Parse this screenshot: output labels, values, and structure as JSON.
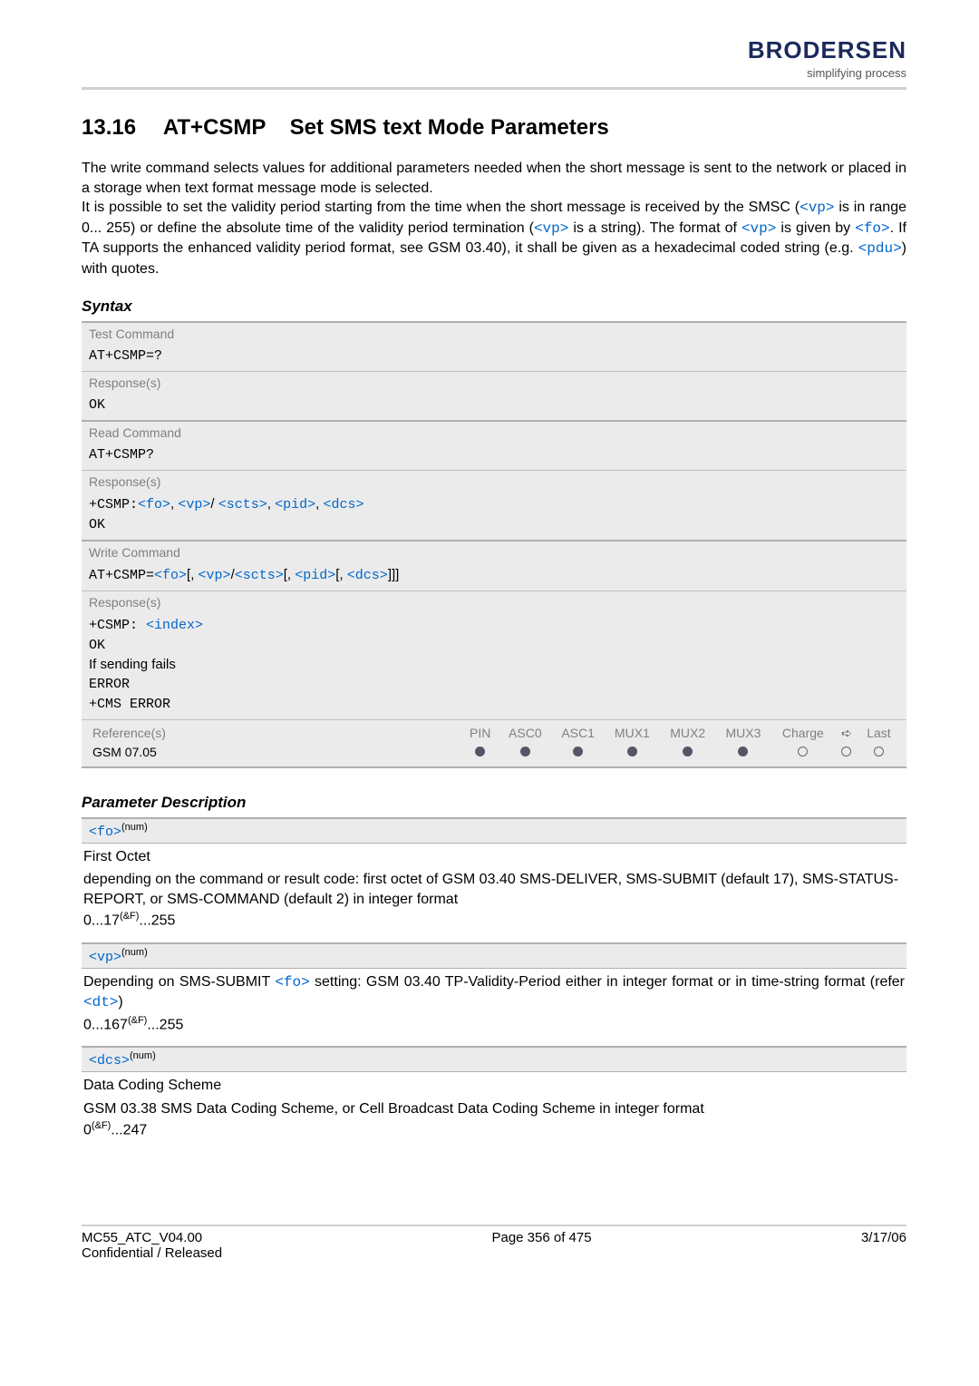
{
  "header": {
    "logo": "BRODERSEN",
    "tagline": "simplifying process"
  },
  "title": {
    "number": "13.16",
    "command": "AT+CSMP",
    "name": "Set SMS text Mode Parameters"
  },
  "intro": {
    "p1a": "The write command selects values for additional parameters needed when the short message is sent to the network or placed in a storage when text format message mode is selected.",
    "p2a": "It is possible to set the validity period starting from the time when the short message is received by the SMSC (",
    "vp1": "<vp>",
    "p2b": " is in range 0... 255) or define the absolute time of the validity period termination (",
    "vp2": "<vp>",
    "p2c": " is a string). The format of ",
    "vp3": "<vp>",
    "p2d": " is given by ",
    "fo1": "<fo>",
    "p2e": ". If TA supports the enhanced validity period format, see GSM 03.40), it shall be given as a hexadecimal coded string (e.g. ",
    "pdu": "<pdu>",
    "p2f": ") with quotes."
  },
  "labels": {
    "syntax": "Syntax",
    "paramDesc": "Parameter Description",
    "testCmd": "Test Command",
    "readCmd": "Read Command",
    "writeCmd": "Write Command",
    "responses": "Response(s)",
    "references": "Reference(s)"
  },
  "syntax": {
    "testCmd": "AT+CSMP=?",
    "testResp": "OK",
    "readCmd": "AT+CSMP?",
    "readResp_prefix": "+CSMP:",
    "readResp_fo": "<fo>",
    "readResp_c1": ", ",
    "readResp_vp": "<vp>",
    "readResp_slash": "/ ",
    "readResp_scts": "<scts>",
    "readResp_c2": ", ",
    "readResp_pid": "<pid>",
    "readResp_c3": ", ",
    "readResp_dcs": "<dcs>",
    "readResp_ok": "OK",
    "writeCmd_prefix": "AT+CSMP=",
    "writeCmd_fo": "<fo>",
    "writeCmd_b1": "[, ",
    "writeCmd_vp": "<vp>",
    "writeCmd_slash": "/",
    "writeCmd_scts": "<scts>",
    "writeCmd_b2": "[, ",
    "writeCmd_pid": "<pid>",
    "writeCmd_b3": "[, ",
    "writeCmd_dcs": "<dcs>",
    "writeCmd_end": "]]]",
    "writeResp_l1a": "+CSMP: ",
    "writeResp_l1b": "<index>",
    "writeResp_l2": "OK",
    "writeResp_l3": "If sending fails",
    "writeResp_l4": "ERROR",
    "writeResp_l5": "+CMS ERROR"
  },
  "refTable": {
    "headers": [
      "PIN",
      "ASC0",
      "ASC1",
      "MUX1",
      "MUX2",
      "MUX3",
      "Charge",
      "",
      "Last"
    ],
    "ref": "GSM 07.05",
    "dots": [
      "f",
      "f",
      "f",
      "f",
      "f",
      "f",
      "e",
      "e",
      "e"
    ]
  },
  "params": {
    "fo": {
      "tag": "<fo>",
      "sup": "(num)",
      "title": "First Octet",
      "desc": "depending on the command or result code: first octet of GSM 03.40 SMS-DELIVER, SMS-SUBMIT (default 17), SMS-STATUS-REPORT, or SMS-COMMAND (default 2) in integer format",
      "range_a": "0...17",
      "range_sup": "(&F)",
      "range_b": "...255"
    },
    "vp": {
      "tag": "<vp>",
      "sup": "(num)",
      "desc_a": "Depending on SMS-SUBMIT ",
      "desc_fo": "<fo>",
      "desc_b": " setting: GSM 03.40 TP-Validity-Period either in integer format or in time-string format (refer ",
      "desc_dt": "<dt>",
      "desc_c": ")",
      "range_a": "0...167",
      "range_sup": "(&F)",
      "range_b": "...255"
    },
    "dcs": {
      "tag": "<dcs>",
      "sup": "(num)",
      "title": "Data Coding Scheme",
      "desc": "GSM 03.38 SMS Data Coding Scheme, or Cell Broadcast Data Coding Scheme in integer format",
      "range_a": "0",
      "range_sup": "(&F)",
      "range_b": "...247"
    }
  },
  "footer": {
    "left1": "MC55_ATC_V04.00",
    "left2": "Confidential / Released",
    "center": "Page 356 of 475",
    "right": "3/17/06"
  }
}
